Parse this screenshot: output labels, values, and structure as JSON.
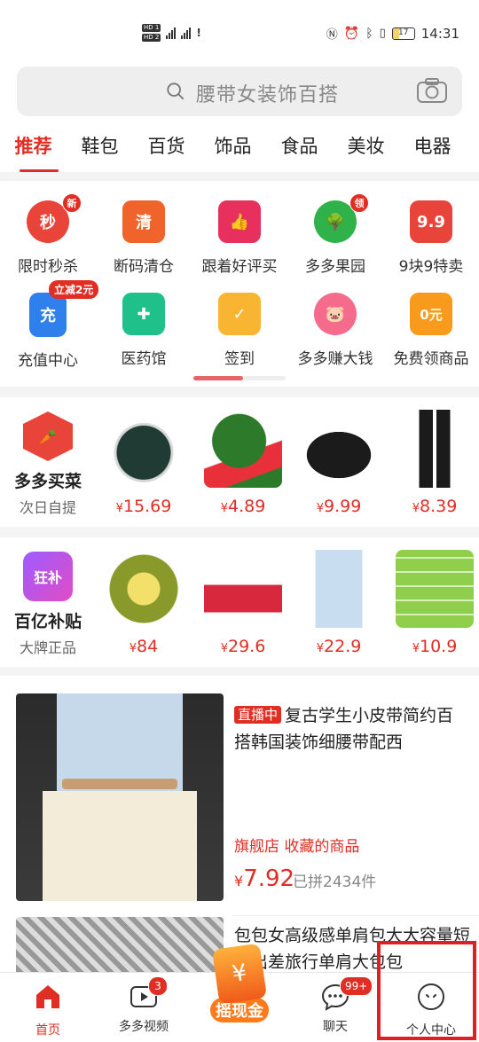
{
  "status_bar": {
    "time": "14:31",
    "battery": "17"
  },
  "search": {
    "placeholder": "腰带女装饰百搭"
  },
  "tabs": [
    "推荐",
    "鞋包",
    "百货",
    "饰品",
    "食品",
    "美妆",
    "电器"
  ],
  "grid": [
    {
      "label": "限时秒杀",
      "icon": "alarm-clock-icon",
      "glyph": "秒",
      "badge": "新",
      "color": "#e8443a"
    },
    {
      "label": "断码清仓",
      "icon": "truck-icon",
      "glyph": "清",
      "color": "#f0642c"
    },
    {
      "label": "跟着好评买",
      "icon": "thumbs-up-icon",
      "glyph": "👍",
      "color": "#e8305e"
    },
    {
      "label": "多多果园",
      "icon": "tree-icon",
      "glyph": "🌳",
      "badge": "领",
      "color": "#2fb24a"
    },
    {
      "label": "9块9特卖",
      "icon": "nine-nine-icon",
      "glyph": "9.9",
      "color": "#e8443a"
    },
    {
      "label": "充值中心",
      "icon": "phone-charge-icon",
      "glyph": "充",
      "pill": "立减2元",
      "color": "#2f80ed"
    },
    {
      "label": "医药馆",
      "icon": "medicine-box-icon",
      "glyph": "✚",
      "color": "#20c08a"
    },
    {
      "label": "签到",
      "icon": "calendar-check-icon",
      "glyph": "✓",
      "color": "#f7b531"
    },
    {
      "label": "多多赚大钱",
      "icon": "piggy-bank-icon",
      "glyph": "🐷",
      "color": "#f46b8c"
    },
    {
      "label": "免费领商品",
      "icon": "shopping-bag-icon",
      "glyph": "0元",
      "color": "#f89a1c"
    }
  ],
  "promo1": {
    "title": "多多买菜",
    "subtitle": "次日自提",
    "products": [
      {
        "price": "15.69",
        "name": "lunch-box"
      },
      {
        "price": "4.89",
        "name": "watermelon"
      },
      {
        "price": "9.99",
        "name": "handbag"
      },
      {
        "price": "8.39",
        "name": "pants"
      }
    ]
  },
  "promo2": {
    "title": "百亿补贴",
    "subtitle": "大牌正品",
    "logo_text": "狂补",
    "products": [
      {
        "price": "84",
        "name": "durian"
      },
      {
        "price": "29.6",
        "name": "sports-bra"
      },
      {
        "price": "22.9",
        "name": "sun-jacket"
      },
      {
        "price": "10.9",
        "name": "tissue-pack"
      }
    ]
  },
  "currency": "¥",
  "feed": {
    "live_tag": "直播中",
    "title": "复古学生小皮带简约百搭韩国装饰细腰带配西",
    "tags": "旗舰店  收藏的商品",
    "price": "7.92",
    "sold": "已拼2434件",
    "title2": "包包女高级感单肩包大大容量短途出差旅行单肩大包包"
  },
  "nav": [
    {
      "label": "首页",
      "icon": "home-icon"
    },
    {
      "label": "多多视频",
      "icon": "video-icon",
      "badge": "3"
    },
    {
      "label": "摇现金",
      "icon": "cash-icon"
    },
    {
      "label": "聊天",
      "icon": "chat-icon",
      "badge": "99+"
    },
    {
      "label": "个人中心",
      "icon": "profile-icon"
    }
  ],
  "colors": {
    "brand": "#e02e24"
  }
}
